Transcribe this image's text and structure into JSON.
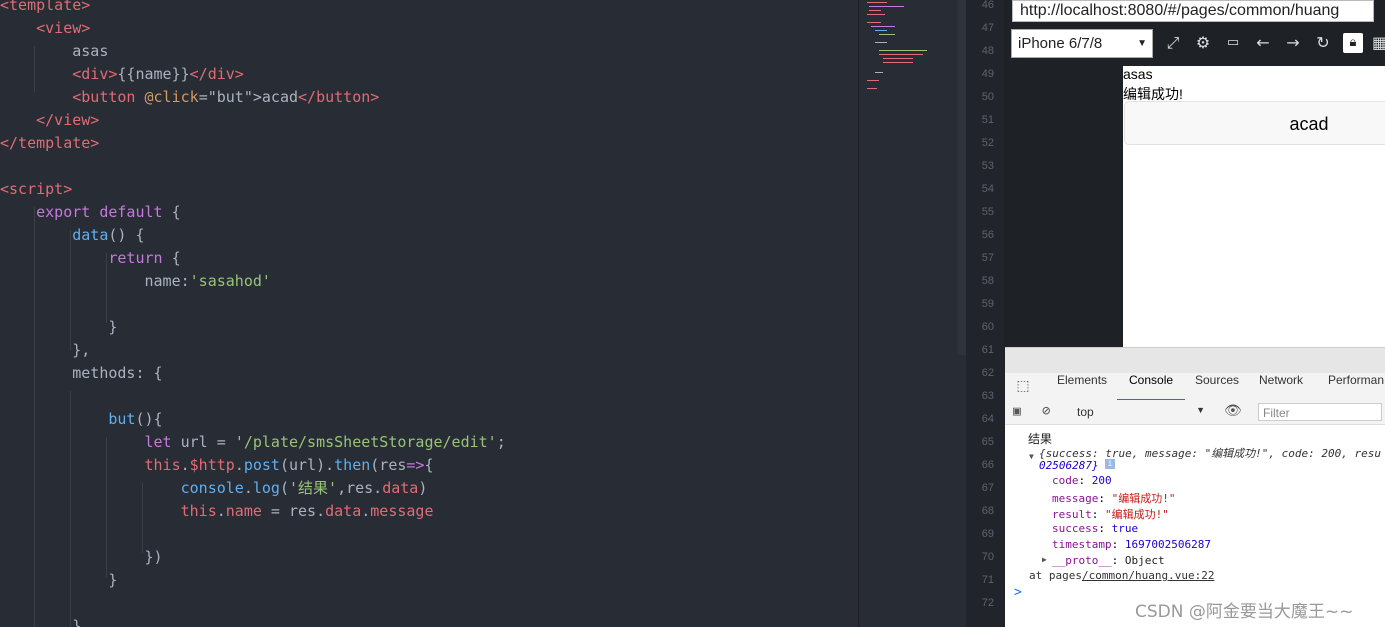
{
  "editor": {
    "lines": [
      [
        [
          "tag",
          "<template>"
        ]
      ],
      [
        [
          "txt",
          "    "
        ],
        [
          "tag",
          "<view>"
        ]
      ],
      [
        [
          "txt",
          "        asas"
        ]
      ],
      [
        [
          "txt",
          "        "
        ],
        [
          "tag",
          "<div>"
        ],
        [
          "txt",
          "{{name}}"
        ],
        [
          "tag",
          "</div>"
        ]
      ],
      [
        [
          "txt",
          "        "
        ],
        [
          "tag",
          "<button"
        ],
        [
          "txt",
          " "
        ],
        [
          "attr",
          "@click"
        ],
        [
          "txt",
          "=\"but\">acad"
        ],
        [
          "tag",
          "</button>"
        ]
      ],
      [
        [
          "txt",
          "    "
        ],
        [
          "tag",
          "</view>"
        ]
      ],
      [
        [
          "tag",
          "</template>"
        ]
      ],
      [
        [
          "txt",
          ""
        ]
      ],
      [
        [
          "tag",
          "<script>"
        ]
      ],
      [
        [
          "txt",
          "    "
        ],
        [
          "kw",
          "export default"
        ],
        [
          "txt",
          " {"
        ]
      ],
      [
        [
          "txt",
          "        "
        ],
        [
          "fn",
          "data"
        ],
        [
          "txt",
          "() {"
        ]
      ],
      [
        [
          "txt",
          "            "
        ],
        [
          "kw",
          "return"
        ],
        [
          "txt",
          " {"
        ]
      ],
      [
        [
          "txt",
          "                name:"
        ],
        [
          "str",
          "'sasahod'"
        ]
      ],
      [
        [
          "txt",
          ""
        ]
      ],
      [
        [
          "txt",
          "            }"
        ]
      ],
      [
        [
          "txt",
          "        },"
        ]
      ],
      [
        [
          "txt",
          "        methods: {"
        ]
      ],
      [
        [
          "txt",
          ""
        ]
      ],
      [
        [
          "txt",
          "            "
        ],
        [
          "fn",
          "but"
        ],
        [
          "txt",
          "(){"
        ]
      ],
      [
        [
          "txt",
          "                "
        ],
        [
          "kw",
          "let"
        ],
        [
          "txt",
          " url = "
        ],
        [
          "str",
          "'/plate/smsSheetStorage/edit'"
        ],
        [
          "txt",
          ";"
        ]
      ],
      [
        [
          "txt",
          "                "
        ],
        [
          "prop",
          "this"
        ],
        [
          "txt",
          "."
        ],
        [
          "prop",
          "$http"
        ],
        [
          "txt",
          "."
        ],
        [
          "fn",
          "post"
        ],
        [
          "txt",
          "(url)."
        ],
        [
          "fn",
          "then"
        ],
        [
          "txt",
          "(res"
        ],
        [
          "kw",
          "=>"
        ],
        [
          "txt",
          "{"
        ]
      ],
      [
        [
          "txt",
          "                    "
        ],
        [
          "fn",
          "console"
        ],
        [
          "txt",
          "."
        ],
        [
          "fn",
          "log"
        ],
        [
          "txt",
          "("
        ],
        [
          "str",
          "'结果'"
        ],
        [
          "txt",
          ",res."
        ],
        [
          "prop",
          "data"
        ],
        [
          "txt",
          ")"
        ]
      ],
      [
        [
          "txt",
          "                    "
        ],
        [
          "prop",
          "this"
        ],
        [
          "txt",
          "."
        ],
        [
          "prop",
          "name"
        ],
        [
          "txt",
          " = res."
        ],
        [
          "prop",
          "data"
        ],
        [
          "txt",
          "."
        ],
        [
          "prop",
          "message"
        ]
      ],
      [
        [
          "txt",
          ""
        ]
      ],
      [
        [
          "txt",
          "                })"
        ]
      ],
      [
        [
          "txt",
          "            }"
        ]
      ],
      [
        [
          "txt",
          ""
        ]
      ],
      [
        [
          "txt",
          "        }"
        ]
      ]
    ]
  },
  "gutter": {
    "line_numbers": [
      "46",
      "47",
      "48",
      "49",
      "50",
      "51",
      "52",
      "53",
      "54",
      "55",
      "56",
      "57",
      "58",
      "59",
      "60",
      "61",
      "62",
      "63",
      "64",
      "65",
      "66",
      "67",
      "68",
      "69",
      "70",
      "71",
      "72"
    ]
  },
  "browser": {
    "url": "http://localhost:8080/#/pages/common/huang",
    "device": "iPhone 6/7/8",
    "toolbar_icons": [
      "screen-rotate-icon",
      "gear-icon",
      "terminal-icon",
      "arrow-left-icon",
      "arrow-right-icon",
      "reload-icon",
      "lock-icon",
      "grid-icon"
    ]
  },
  "viewport": {
    "text1": "asas",
    "text2": "编辑成功!",
    "button_label": "acad"
  },
  "devtools": {
    "tabs": [
      "Elements",
      "Console",
      "Sources",
      "Network",
      "Performan"
    ],
    "active_tab": "Console",
    "context": "top",
    "filter_placeholder": "Filter",
    "console": {
      "log_label": "结果",
      "object_summary_1": "{success: true, message: \"编辑成功!\", code: 200, resu",
      "object_summary_2": "02506287}",
      "props": [
        {
          "key": "code",
          "value": "200"
        },
        {
          "key": "message",
          "value": "\"编辑成功!\""
        },
        {
          "key": "result",
          "value": "\"编辑成功!\""
        },
        {
          "key": "success",
          "value": "true"
        },
        {
          "key": "timestamp",
          "value": "1697002506287"
        },
        {
          "key": "__proto__",
          "value": "Object"
        }
      ],
      "source_prefix": "at pages",
      "source_link": "/common/huang.vue:22",
      "prompt": ">"
    }
  },
  "watermark": "CSDN @阿金要当大魔王~~"
}
